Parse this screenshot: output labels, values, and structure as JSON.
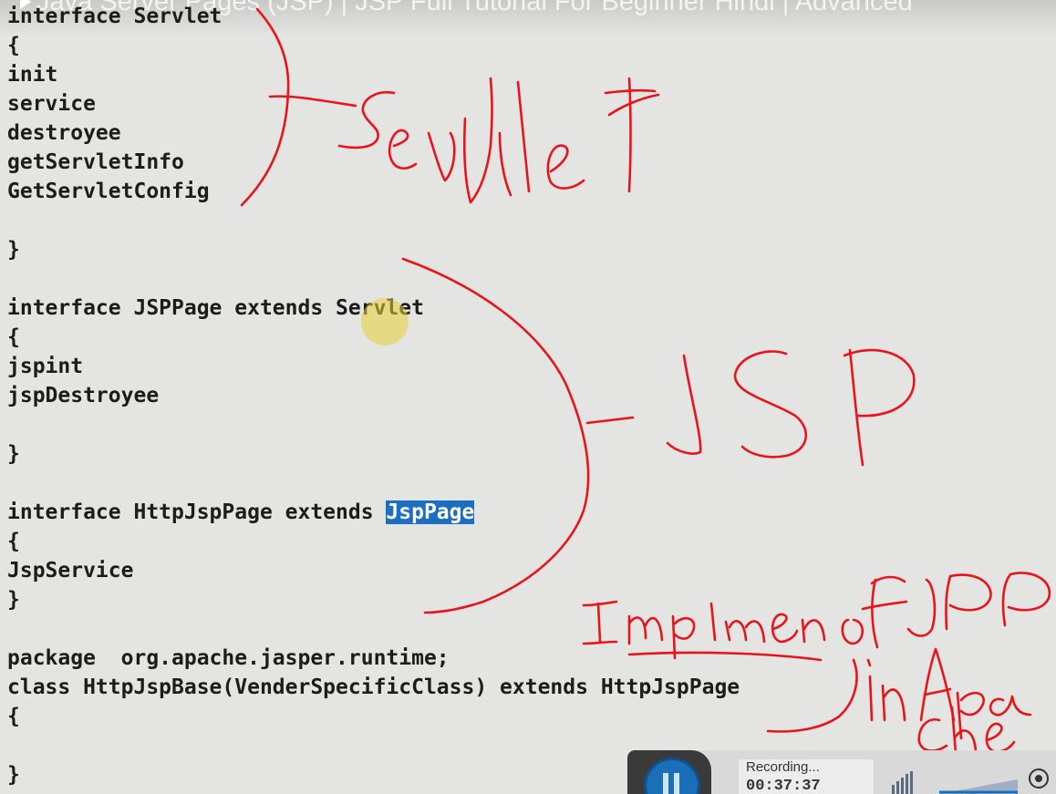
{
  "video": {
    "title": "Java Server Pages (JSP) | JSP Full Tutorial For Beginner Hindi | Advanced"
  },
  "editor": {
    "lines": [
      "interface Servlet",
      "{",
      "init",
      "service",
      "destroyee",
      "getServletInfo",
      "GetServletConfig",
      "",
      "}",
      "",
      "interface JSPPage extends Servlet",
      "{",
      "jspint",
      "jspDestroyee",
      "",
      "}",
      "",
      "interface HttpJspPage extends ",
      "{",
      "JspService",
      "}",
      "",
      "package  org.apache.jasper.runtime;",
      "class HttpJspBase(VenderSpecificClass) extends HttpJspPage",
      "{",
      "",
      "}"
    ],
    "selected_text": "JspPage",
    "selection_color": "#1a6fc2"
  },
  "annotations": {
    "ink_color": "#e8141b",
    "labels": [
      "Servlet",
      "JSP",
      "Implmen of JSP",
      "in Apa che"
    ]
  },
  "recorder": {
    "status": "Recording...",
    "time": "00:37:37",
    "pause_icon": "pause-icon",
    "accent": "#1a6fb8"
  }
}
